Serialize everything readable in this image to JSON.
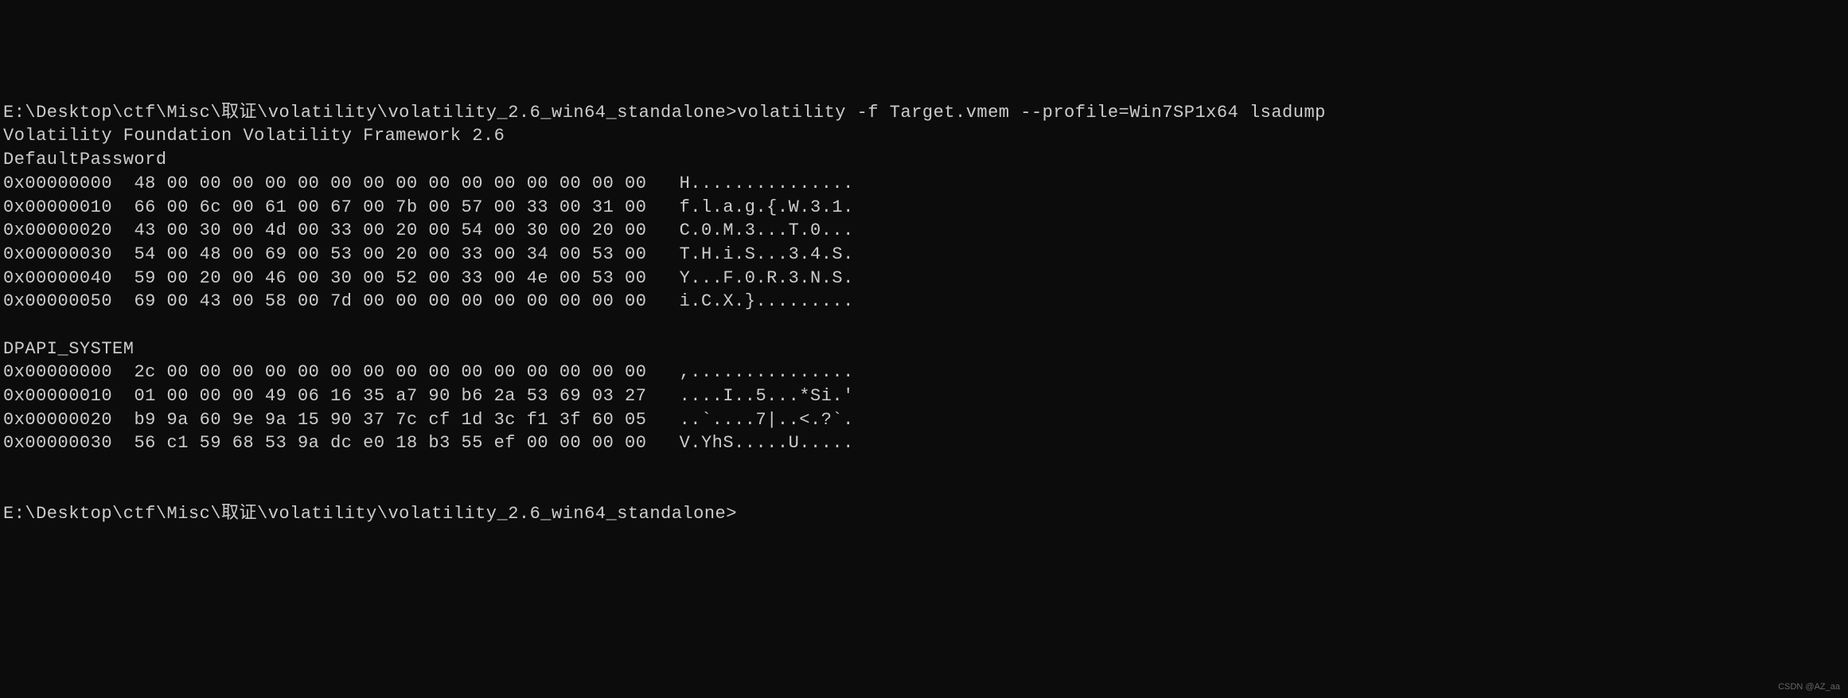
{
  "terminal": {
    "prompt_path": "E:\\Desktop\\ctf\\Misc\\取证\\volatility\\volatility_2.6_win64_standalone>",
    "command": "volatility -f Target.vmem --profile=Win7SP1x64 lsadump",
    "header": "Volatility Foundation Volatility Framework 2.6",
    "sections": [
      {
        "title": "DefaultPassword",
        "rows": [
          {
            "offset": "0x00000000",
            "hex": "48 00 00 00 00 00 00 00 00 00 00 00 00 00 00 00",
            "ascii": "H..............."
          },
          {
            "offset": "0x00000010",
            "hex": "66 00 6c 00 61 00 67 00 7b 00 57 00 33 00 31 00",
            "ascii": "f.l.a.g.{.W.3.1."
          },
          {
            "offset": "0x00000020",
            "hex": "43 00 30 00 4d 00 33 00 20 00 54 00 30 00 20 00",
            "ascii": "C.0.M.3...T.0..."
          },
          {
            "offset": "0x00000030",
            "hex": "54 00 48 00 69 00 53 00 20 00 33 00 34 00 53 00",
            "ascii": "T.H.i.S...3.4.S."
          },
          {
            "offset": "0x00000040",
            "hex": "59 00 20 00 46 00 30 00 52 00 33 00 4e 00 53 00",
            "ascii": "Y...F.0.R.3.N.S."
          },
          {
            "offset": "0x00000050",
            "hex": "69 00 43 00 58 00 7d 00 00 00 00 00 00 00 00 00",
            "ascii": "i.C.X.}........."
          }
        ]
      },
      {
        "title": "DPAPI_SYSTEM",
        "rows": [
          {
            "offset": "0x00000000",
            "hex": "2c 00 00 00 00 00 00 00 00 00 00 00 00 00 00 00",
            "ascii": ",..............."
          },
          {
            "offset": "0x00000010",
            "hex": "01 00 00 00 49 06 16 35 a7 90 b6 2a 53 69 03 27",
            "ascii": "....I..5...*Si.'"
          },
          {
            "offset": "0x00000020",
            "hex": "b9 9a 60 9e 9a 15 90 37 7c cf 1d 3c f1 3f 60 05",
            "ascii": "..`....7|..<.?`."
          },
          {
            "offset": "0x00000030",
            "hex": "56 c1 59 68 53 9a dc e0 18 b3 55 ef 00 00 00 00",
            "ascii": "V.YhS.....U....."
          }
        ]
      }
    ],
    "prompt_end": "E:\\Desktop\\ctf\\Misc\\取证\\volatility\\volatility_2.6_win64_standalone>"
  },
  "watermark": "CSDN @AZ_aa"
}
